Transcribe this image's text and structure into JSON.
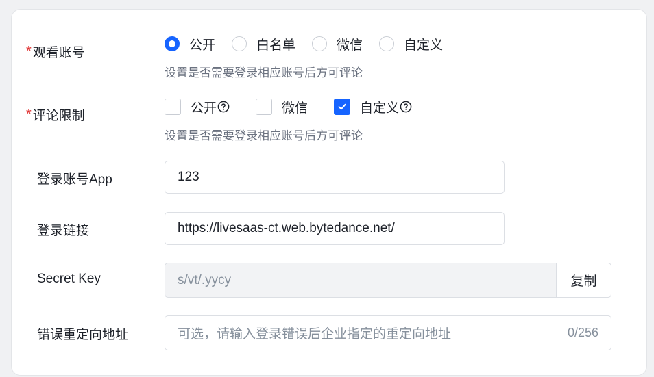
{
  "form": {
    "watch_account": {
      "label": "观看账号",
      "required_mark": "*",
      "options": [
        "公开",
        "白名单",
        "微信",
        "自定义"
      ],
      "selected": "公开",
      "hint": "设置是否需要登录相应账号后方可评论"
    },
    "comment_limit": {
      "label": "评论限制",
      "required_mark": "*",
      "options": [
        "公开",
        "微信",
        "自定义"
      ],
      "checked": [
        "自定义"
      ],
      "hint": "设置是否需要登录相应账号后方可评论"
    },
    "login_app": {
      "label": "登录账号App",
      "value": "123"
    },
    "login_link": {
      "label": "登录链接",
      "value": "https://livesaas-ct.web.bytedance.net/"
    },
    "secret_key": {
      "label": "Secret Key",
      "value": "s/vt/.yycy",
      "copy_label": "复制"
    },
    "error_redirect": {
      "label": "错误重定向地址",
      "placeholder": "可选，请输入登录错误后企业指定的重定向地址",
      "counter": "0/256"
    }
  },
  "colors": {
    "accent": "#1664ff",
    "required": "#e03131"
  }
}
